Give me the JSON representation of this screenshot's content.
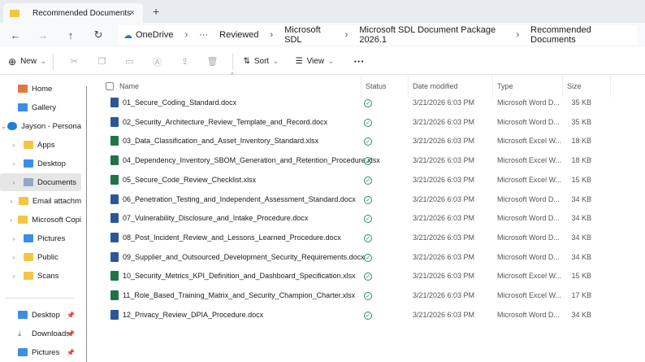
{
  "window": {
    "tab_title": "Recommended Documents",
    "new_tab": "+",
    "close": "×"
  },
  "address": {
    "breadcrumb": [
      "OneDrive",
      "···",
      "Reviewed",
      "Microsoft SDL",
      "Microsoft SDL Document Package 2026.1",
      "Recommended Documents"
    ]
  },
  "toolbar": {
    "new_label": "New",
    "sort_label": "Sort",
    "view_label": "View",
    "more": "···"
  },
  "sidebar": {
    "items": [
      "Home",
      "Gallery",
      "Jayson - Persona",
      "Apps",
      "Desktop",
      "Documents",
      "Email attachm",
      "Microsoft Copi",
      "Pictures",
      "Public",
      "Scans"
    ],
    "quick": [
      "Desktop",
      "Downloads",
      "Pictures"
    ]
  },
  "columns": {
    "name": "Name",
    "status": "Status",
    "date": "Date modified",
    "type": "Type",
    "size": "Size"
  },
  "files": [
    {
      "name": "01_Secure_Coding_Standard.docx",
      "date": "3/21/2026 6:03 PM",
      "type": "Microsoft Word D...",
      "size": "35 KB",
      "kind": "word"
    },
    {
      "name": "02_Security_Architecture_Review_Template_and_Record.docx",
      "date": "3/21/2026 6:03 PM",
      "type": "Microsoft Word D...",
      "size": "35 KB",
      "kind": "word"
    },
    {
      "name": "03_Data_Classification_and_Asset_Inventory_Standard.xlsx",
      "date": "3/21/2026 6:03 PM",
      "type": "Microsoft Excel W...",
      "size": "18 KB",
      "kind": "excel"
    },
    {
      "name": "04_Dependency_Inventory_SBOM_Generation_and_Retention_Procedure.xlsx",
      "date": "3/21/2026 6:03 PM",
      "type": "Microsoft Excel W...",
      "size": "18 KB",
      "kind": "excel"
    },
    {
      "name": "05_Secure_Code_Review_Checklist.xlsx",
      "date": "3/21/2026 6:03 PM",
      "type": "Microsoft Excel W...",
      "size": "15 KB",
      "kind": "excel"
    },
    {
      "name": "06_Penetration_Testing_and_Independent_Assessment_Standard.docx",
      "date": "3/21/2026 6:03 PM",
      "type": "Microsoft Word D...",
      "size": "34 KB",
      "kind": "word"
    },
    {
      "name": "07_Vulnerability_Disclosure_and_Intake_Procedure.docx",
      "date": "3/21/2026 6:03 PM",
      "type": "Microsoft Word D...",
      "size": "34 KB",
      "kind": "word"
    },
    {
      "name": "08_Post_Incident_Review_and_Lessons_Learned_Procedure.docx",
      "date": "3/21/2026 6:03 PM",
      "type": "Microsoft Word D...",
      "size": "34 KB",
      "kind": "word"
    },
    {
      "name": "09_Supplier_and_Outsourced_Development_Security_Requirements.docx",
      "date": "3/21/2026 6:03 PM",
      "type": "Microsoft Word D...",
      "size": "34 KB",
      "kind": "word"
    },
    {
      "name": "10_Security_Metrics_KPI_Definition_and_Dashboard_Specification.xlsx",
      "date": "3/21/2026 6:03 PM",
      "type": "Microsoft Excel W...",
      "size": "15 KB",
      "kind": "excel"
    },
    {
      "name": "11_Role_Based_Training_Matrix_and_Security_Champion_Charter.xlsx",
      "date": "3/21/2026 6:03 PM",
      "type": "Microsoft Excel W...",
      "size": "17 KB",
      "kind": "excel"
    },
    {
      "name": "12_Privacy_Review_DPIA_Procedure.docx",
      "date": "3/21/2026 6:03 PM",
      "type": "Microsoft Word D...",
      "size": "34 KB",
      "kind": "word"
    }
  ],
  "colors": {
    "word": "#2b579a",
    "excel": "#217346",
    "status": "#2e8b57"
  }
}
